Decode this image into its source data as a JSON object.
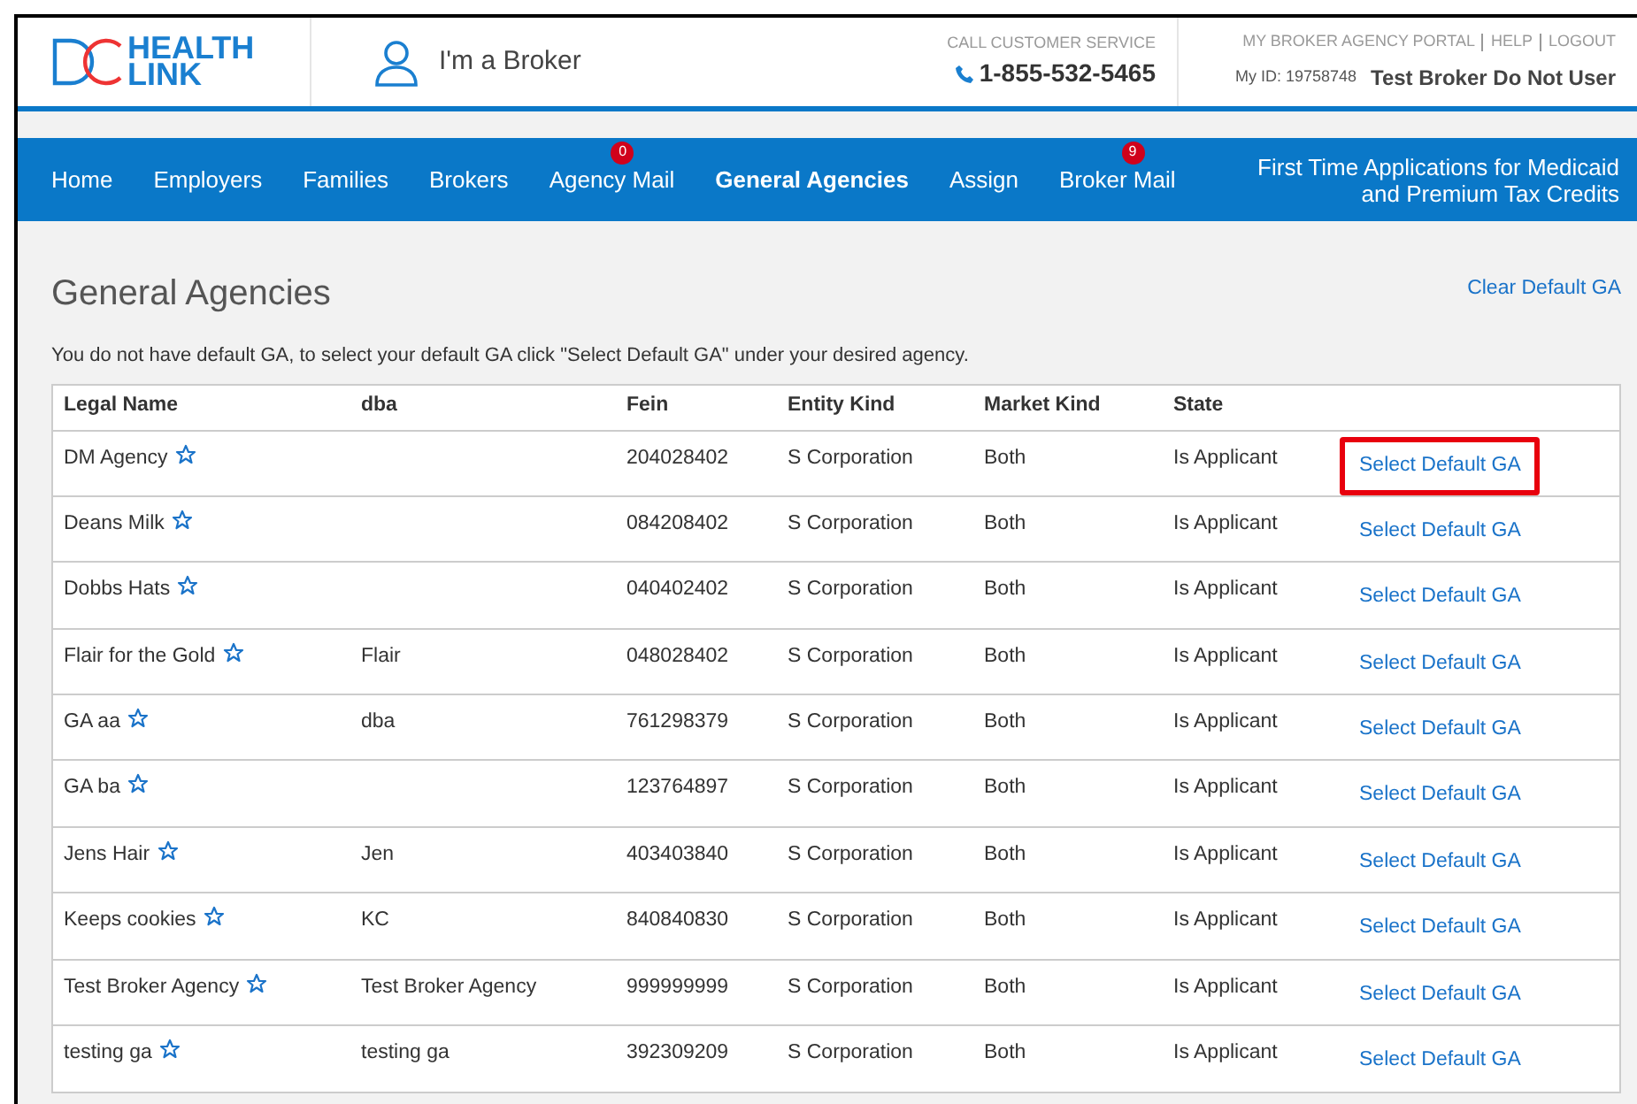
{
  "header": {
    "logo": {
      "top": "HEALTH",
      "bottom": "LINK"
    },
    "role": "I'm a Broker",
    "service_label": "CALL CUSTOMER SERVICE",
    "phone": "1-855-532-5465",
    "links": [
      "MY BROKER AGENCY PORTAL",
      "HELP",
      "LOGOUT"
    ],
    "my_id": "My ID: 19758748",
    "user": "Test Broker Do Not User"
  },
  "nav": {
    "items": [
      {
        "label": "Home",
        "selected": false
      },
      {
        "label": "Employers",
        "selected": false
      },
      {
        "label": "Families",
        "selected": false
      },
      {
        "label": "Brokers",
        "selected": false
      },
      {
        "label": "Agency Mail",
        "selected": false,
        "badge": "0"
      },
      {
        "label": "General Agencies",
        "selected": true
      },
      {
        "label": "Assign",
        "selected": false
      },
      {
        "label": "Broker Mail",
        "selected": false,
        "badge": "9"
      }
    ],
    "right": "First Time Applications for Medicaid and Premium Tax Credits"
  },
  "page": {
    "title": "General Agencies",
    "clear_link": "Clear Default GA",
    "notice": "You do not have default GA, to select your default GA click \"Select Default GA\" under your desired agency."
  },
  "table": {
    "columns": [
      "Legal Name",
      "dba",
      "Fein",
      "Entity Kind",
      "Market Kind",
      "State"
    ],
    "rows": [
      {
        "name": "DM Agency",
        "dba": "",
        "fein": "204028402",
        "entity": "S Corporation",
        "market": "Both",
        "state": "Is Applicant",
        "action": "Select Default GA",
        "highlighted": true
      },
      {
        "name": "Deans Milk",
        "dba": "",
        "fein": "084208402",
        "entity": "S Corporation",
        "market": "Both",
        "state": "Is Applicant",
        "action": "Select Default GA",
        "highlighted": false
      },
      {
        "name": "Dobbs Hats",
        "dba": "",
        "fein": "040402402",
        "entity": "S Corporation",
        "market": "Both",
        "state": "Is Applicant",
        "action": "Select Default GA",
        "highlighted": false
      },
      {
        "name": "Flair for the Gold",
        "dba": "Flair",
        "fein": "048028402",
        "entity": "S Corporation",
        "market": "Both",
        "state": "Is Applicant",
        "action": "Select Default GA",
        "highlighted": false
      },
      {
        "name": "GA aa",
        "dba": "dba",
        "fein": "761298379",
        "entity": "S Corporation",
        "market": "Both",
        "state": "Is Applicant",
        "action": "Select Default GA",
        "highlighted": false
      },
      {
        "name": "GA ba",
        "dba": "",
        "fein": "123764897",
        "entity": "S Corporation",
        "market": "Both",
        "state": "Is Applicant",
        "action": "Select Default GA",
        "highlighted": false
      },
      {
        "name": "Jens Hair",
        "dba": "Jen",
        "fein": "403403840",
        "entity": "S Corporation",
        "market": "Both",
        "state": "Is Applicant",
        "action": "Select Default GA",
        "highlighted": false
      },
      {
        "name": "Keeps cookies",
        "dba": "KC",
        "fein": "840840830",
        "entity": "S Corporation",
        "market": "Both",
        "state": "Is Applicant",
        "action": "Select Default GA",
        "highlighted": false
      },
      {
        "name": "Test Broker Agency",
        "dba": "Test Broker Agency",
        "fein": "999999999",
        "entity": "S Corporation",
        "market": "Both",
        "state": "Is Applicant",
        "action": "Select Default GA",
        "highlighted": false
      },
      {
        "name": "testing ga",
        "dba": "testing ga",
        "fein": "392309209",
        "entity": "S Corporation",
        "market": "Both",
        "state": "Is Applicant",
        "action": "Select Default GA",
        "highlighted": false
      }
    ]
  }
}
